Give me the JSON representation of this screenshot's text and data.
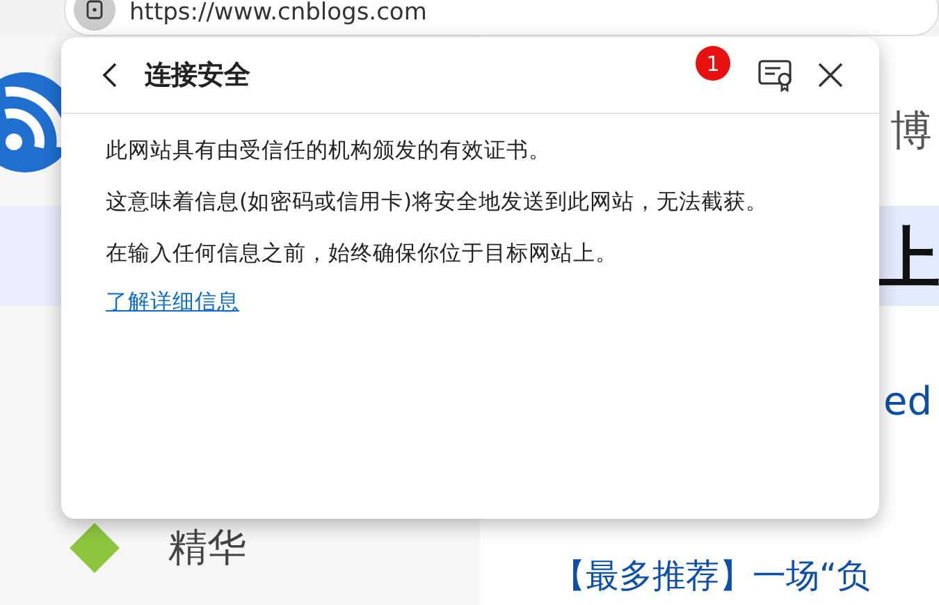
{
  "address_bar": {
    "url": "https://www.cnblogs.com"
  },
  "page": {
    "sidebar_item": "精华",
    "heading_fragment": "博",
    "title_fragment": "上",
    "link_fragment": "ed",
    "recommend_fragment": "【最多推荐】一场“负"
  },
  "popup": {
    "title": "连接安全",
    "badge": "1",
    "paragraphs": [
      "此网站具有由受信任的机构颁发的有效证书。",
      "这意味着信息(如密码或信用卡)将安全地发送到此网站，无法截获。",
      "在输入任何信息之前，始终确保你位于目标网站上。"
    ],
    "link": "了解详细信息"
  }
}
